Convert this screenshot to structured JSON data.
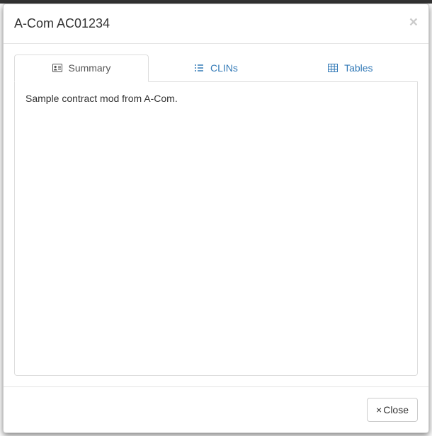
{
  "modal": {
    "title": "A-Com AC01234",
    "close_icon": "×"
  },
  "tabs": [
    {
      "label": "Summary",
      "icon": "id-card-icon",
      "active": true
    },
    {
      "label": "CLINs",
      "icon": "list-icon",
      "active": false
    },
    {
      "label": "Tables",
      "icon": "table-icon",
      "active": false
    }
  ],
  "content": {
    "summary_text": "Sample contract mod from A-Com."
  },
  "footer": {
    "close_label": "Close",
    "close_x": "×"
  }
}
